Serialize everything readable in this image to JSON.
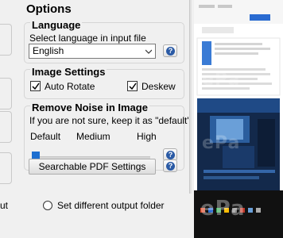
{
  "options": {
    "title": "Options",
    "language": {
      "title": "Language",
      "hint": "Select language in input file",
      "selected": "English"
    },
    "image_settings": {
      "title": "Image Settings",
      "auto_rotate": "Auto Rotate",
      "auto_rotate_checked": true,
      "deskew": "Deskew",
      "deskew_checked": true
    },
    "remove_noise": {
      "title": "Remove Noise in Image",
      "hint": "If you are not sure, keep it as \"default\"",
      "levels": [
        "Default",
        "Medium",
        "High"
      ],
      "value_index": 0
    },
    "searchable_pdf_button": "Searchable PDF Settings"
  },
  "output": {
    "left_fragment": "ut",
    "different_folder_label": "Set different output folder"
  },
  "colors": {
    "accent": "#1e6fd0",
    "help_icon": "#2a5aa5"
  }
}
